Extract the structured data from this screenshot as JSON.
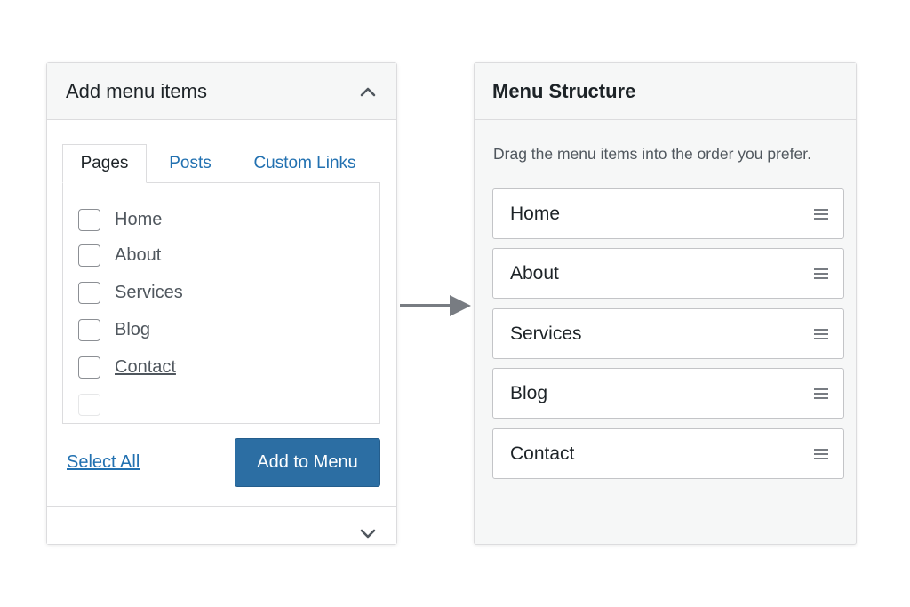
{
  "add_panel": {
    "title": "Add menu items",
    "tabs": [
      {
        "label": "Pages",
        "active": true
      },
      {
        "label": "Posts",
        "active": false
      },
      {
        "label": "Custom Links",
        "active": false
      }
    ],
    "pages": [
      {
        "label": "Home",
        "checked": false
      },
      {
        "label": "About",
        "checked": false
      },
      {
        "label": "Services",
        "checked": false
      },
      {
        "label": "Blog",
        "checked": false
      },
      {
        "label": "Contact",
        "checked": false
      }
    ],
    "select_all_label": "Select All",
    "add_button_label": "Add to Menu"
  },
  "structure_panel": {
    "title": "Menu Structure",
    "instructions": "Drag the menu items into the order you prefer.",
    "items": [
      {
        "label": "Home"
      },
      {
        "label": "About"
      },
      {
        "label": "Services"
      },
      {
        "label": "Blog"
      },
      {
        "label": "Contact"
      }
    ]
  },
  "colors": {
    "accent": "#2271b1",
    "button": "#2c6ea3",
    "border": "#dcdcde",
    "panel_bg": "#f6f7f7",
    "arrow": "#787c82"
  },
  "icons": {
    "collapse": "chevron-up-icon",
    "expand": "chevron-down-icon",
    "flow": "arrow-right-icon",
    "drag": "drag-handle-icon"
  }
}
